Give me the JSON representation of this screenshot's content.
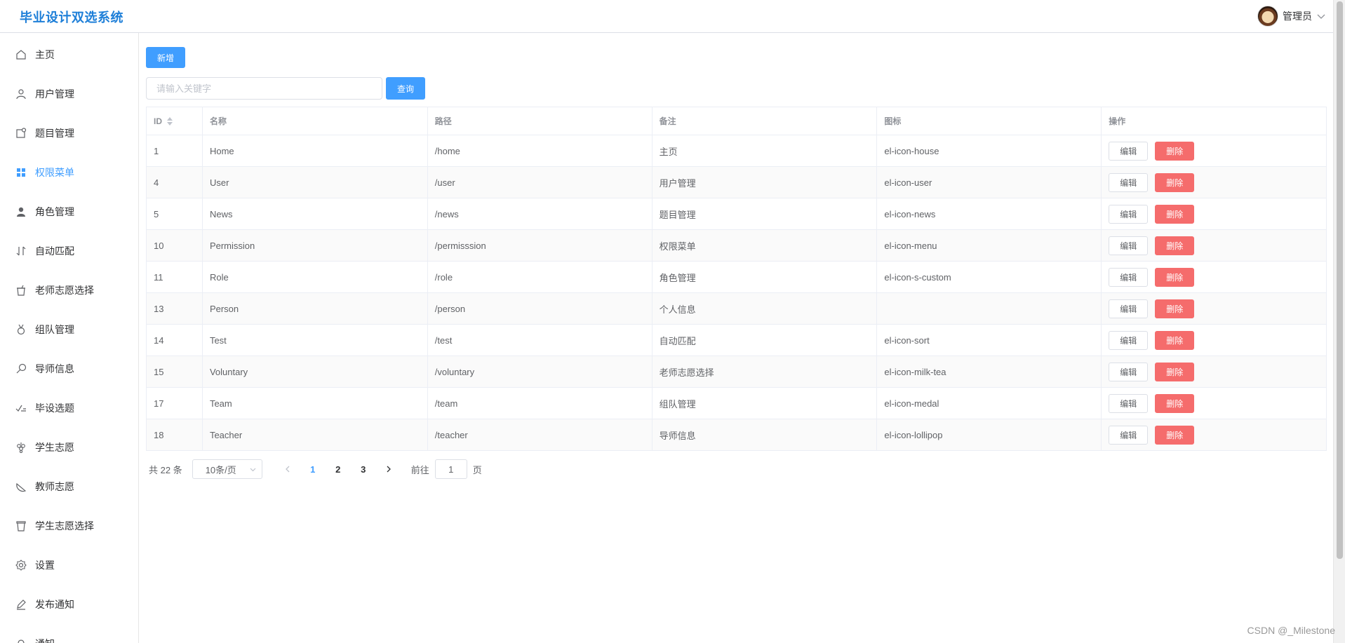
{
  "header": {
    "brand": "毕业设计双选系统",
    "user_name": "管理员"
  },
  "sidebar": {
    "items": [
      {
        "label": "主页",
        "icon": "house-icon"
      },
      {
        "label": "用户管理",
        "icon": "user-icon"
      },
      {
        "label": "题目管理",
        "icon": "news-icon"
      },
      {
        "label": "权限菜单",
        "icon": "menu-icon",
        "active": true
      },
      {
        "label": "角色管理",
        "icon": "custom-icon"
      },
      {
        "label": "自动匹配",
        "icon": "sort-icon"
      },
      {
        "label": "老师志愿选择",
        "icon": "milk-tea-icon"
      },
      {
        "label": "组队管理",
        "icon": "medal-icon"
      },
      {
        "label": "导师信息",
        "icon": "lollipop-icon"
      },
      {
        "label": "毕设选题",
        "icon": "finished-icon"
      },
      {
        "label": "学生志愿",
        "icon": "grape-icon"
      },
      {
        "label": "教师志愿",
        "icon": "watermelon-icon"
      },
      {
        "label": "学生志愿选择",
        "icon": "coffee-cup-icon"
      },
      {
        "label": "设置",
        "icon": "setting-icon"
      },
      {
        "label": "发布通知",
        "icon": "edit-icon"
      },
      {
        "label": "通知",
        "icon": "bell-icon"
      }
    ]
  },
  "toolbar": {
    "add_label": "新增",
    "search_placeholder": "请输入关键字",
    "search_label": "查询"
  },
  "table": {
    "headers": {
      "id": "ID",
      "name": "名称",
      "path": "路径",
      "remark": "备注",
      "icon": "图标",
      "ops": "操作"
    },
    "edit_label": "编辑",
    "delete_label": "删除",
    "rows": [
      {
        "id": "1",
        "name": "Home",
        "path": "/home",
        "remark": "主页",
        "icon": "el-icon-house"
      },
      {
        "id": "4",
        "name": "User",
        "path": "/user",
        "remark": "用户管理",
        "icon": "el-icon-user"
      },
      {
        "id": "5",
        "name": "News",
        "path": "/news",
        "remark": "题目管理",
        "icon": "el-icon-news"
      },
      {
        "id": "10",
        "name": "Permission",
        "path": "/permisssion",
        "remark": "权限菜单",
        "icon": "el-icon-menu"
      },
      {
        "id": "11",
        "name": "Role",
        "path": "/role",
        "remark": "角色管理",
        "icon": "el-icon-s-custom"
      },
      {
        "id": "13",
        "name": "Person",
        "path": "/person",
        "remark": "个人信息",
        "icon": ""
      },
      {
        "id": "14",
        "name": "Test",
        "path": "/test",
        "remark": "自动匹配",
        "icon": "el-icon-sort"
      },
      {
        "id": "15",
        "name": "Voluntary",
        "path": "/voluntary",
        "remark": "老师志愿选择",
        "icon": "el-icon-milk-tea"
      },
      {
        "id": "17",
        "name": "Team",
        "path": "/team",
        "remark": "组队管理",
        "icon": "el-icon-medal"
      },
      {
        "id": "18",
        "name": "Teacher",
        "path": "/teacher",
        "remark": "导师信息",
        "icon": "el-icon-lollipop"
      }
    ]
  },
  "pagination": {
    "total": "共 22 条",
    "page_size": "10条/页",
    "pages": [
      "1",
      "2",
      "3"
    ],
    "current": "1",
    "goto_prefix": "前往",
    "goto_value": "1",
    "goto_suffix": "页"
  },
  "watermark": "CSDN @_Milestone",
  "colors": {
    "primary": "#409eff",
    "danger": "#f56c6c",
    "brand": "#1e7fd8"
  }
}
